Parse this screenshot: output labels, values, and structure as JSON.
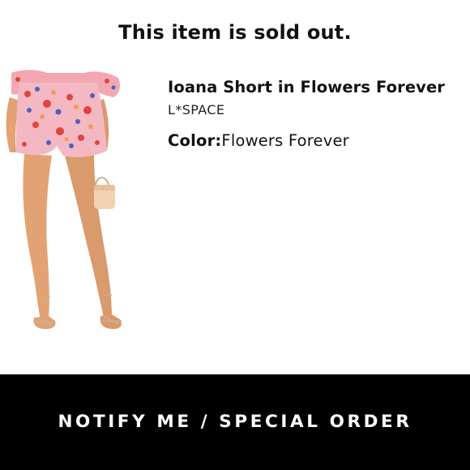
{
  "banner": {
    "sold_out_text": "This item is sold out."
  },
  "product": {
    "name": "Ioana Short in Flowers Forever",
    "brand": "L*SPACE",
    "color_label": "Color:",
    "color_value": "Flowers Forever",
    "image_icon": "product-photo"
  },
  "action": {
    "notify_label": "NOTIFY ME / SPECIAL ORDER"
  },
  "colors": {
    "button_background": "#000000",
    "button_text": "#ffffff",
    "page_background": "#ffffff",
    "text": "#111111"
  }
}
